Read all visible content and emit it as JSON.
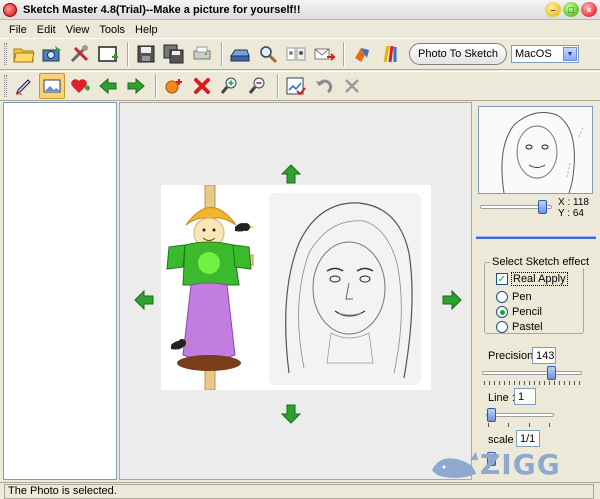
{
  "window": {
    "title": "Sketch Master 4.8(Trial)--Make a picture for yourself!!",
    "min_label": "–",
    "max_label": "□",
    "close_label": "×"
  },
  "menu": {
    "items": [
      "File",
      "Edit",
      "View",
      "Tools",
      "Help"
    ]
  },
  "toolbar": {
    "photo_to_sketch_label": "Photo To Sketch",
    "style_select_value": "MacOS"
  },
  "right_panel": {
    "coord_x": "X : 118",
    "coord_y": "Y : 64",
    "effect_group_title": "Select Sketch effect",
    "real_apply_label": "Real Apply",
    "real_apply_checked": true,
    "options": [
      "Pen",
      "Pencil",
      "Pastel"
    ],
    "selected_option": "Pencil",
    "precision_label": "Precision:",
    "precision_value": "143",
    "line_label": "Line :",
    "line_value": "1",
    "scale_label": "scale :",
    "scale_value": "1/1"
  },
  "watermark": {
    "text": "ZIGG"
  },
  "status": {
    "text": "The Photo is selected."
  },
  "colors": {
    "accent": "#3a6bd0",
    "arrow_green": "#2ea12e",
    "delete_red": "#d81f1f"
  }
}
